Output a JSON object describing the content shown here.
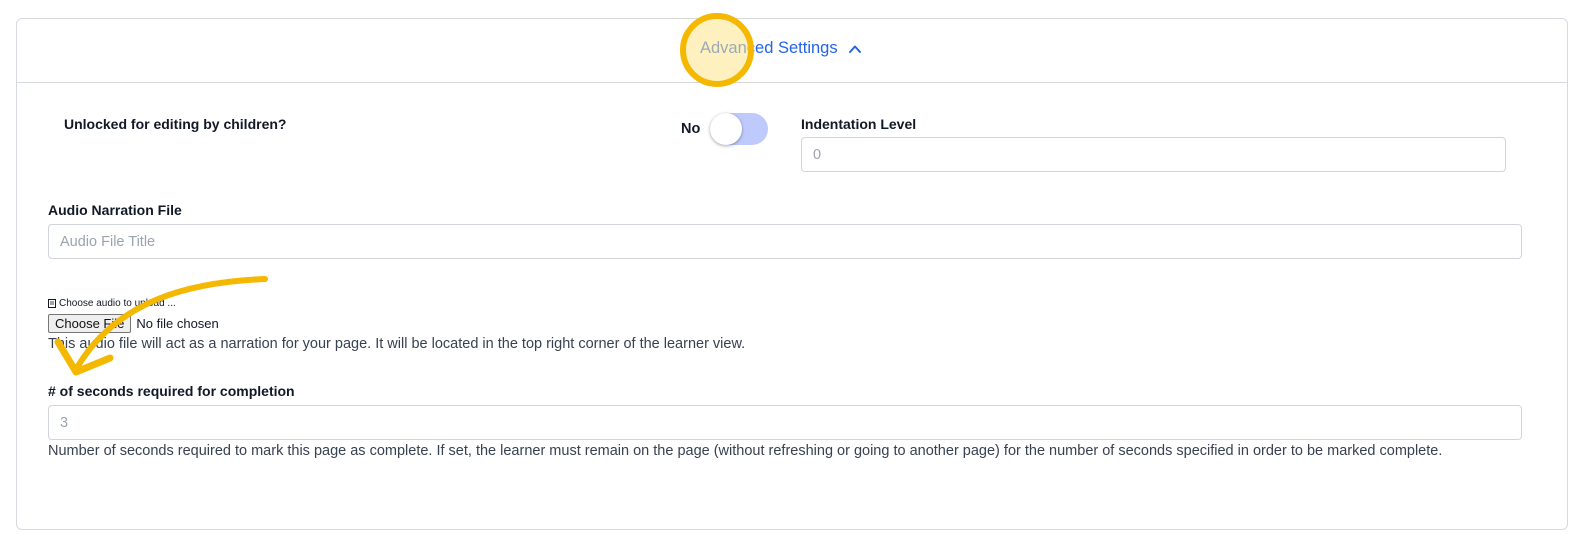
{
  "header": {
    "advanced_settings_label": "Advanced Settings"
  },
  "unlocked": {
    "label": "Unlocked for editing by children?",
    "toggle_text": "No",
    "enabled": false
  },
  "indentation": {
    "label": "Indentation Level",
    "placeholder": "0"
  },
  "audio": {
    "label": "Audio Narration File",
    "placeholder": "Audio File Title",
    "upload_hint": "Choose audio to upload ...",
    "choose_button": "Choose File",
    "file_status": "No file chosen",
    "help_text": "This audio file will act as a narration for your page. It will be located in the top right corner of the learner view."
  },
  "completion": {
    "label": "# of seconds required for completion",
    "placeholder": "3",
    "help_text": "Number of seconds required to mark this page as complete. If set, the learner must remain on the page (without refreshing or going to another page) for the number of seconds specified in order to be marked complete."
  },
  "colors": {
    "accent": "#2563eb",
    "toggle_track": "#bfcafc",
    "annotation": "#f5b800"
  },
  "icons": {
    "collapse": "chevron-up-icon",
    "upload_hint": "document-icon"
  }
}
